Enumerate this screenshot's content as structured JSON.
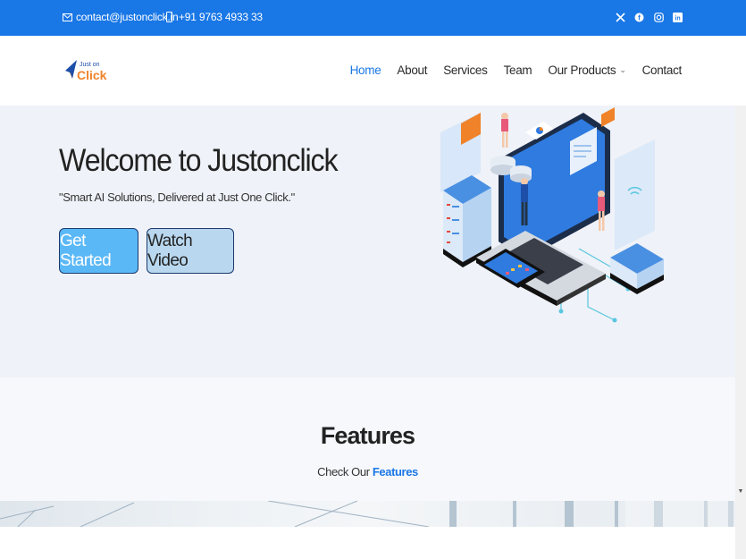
{
  "topbar": {
    "email": "contact@justonclick.in",
    "phone": "+91 9763 4933 33",
    "social_icons": [
      "x-icon",
      "facebook-icon",
      "instagram-icon",
      "linkedin-icon"
    ]
  },
  "logo": {
    "line1": "Just on",
    "line2": "Click"
  },
  "nav": {
    "items": [
      {
        "label": "Home",
        "active": true
      },
      {
        "label": "About"
      },
      {
        "label": "Services"
      },
      {
        "label": "Team"
      },
      {
        "label": "Our Products",
        "dropdown": true
      },
      {
        "label": "Contact"
      }
    ]
  },
  "hero": {
    "title": "Welcome to Justonclick",
    "subtitle": "\"Smart AI Solutions, Delivered at Just One Click.\"",
    "primary_button": "Get Started",
    "secondary_button": "Watch Video"
  },
  "features": {
    "title": "Features",
    "sub_prefix": "Check Our",
    "sub_highlight": "Features"
  },
  "colors": {
    "brand_blue": "#1977e6",
    "hero_bg": "#eff2f8",
    "btn_primary": "#5bb8f7",
    "btn_secondary": "#b9d8f0",
    "logo_orange": "#f0822a"
  }
}
